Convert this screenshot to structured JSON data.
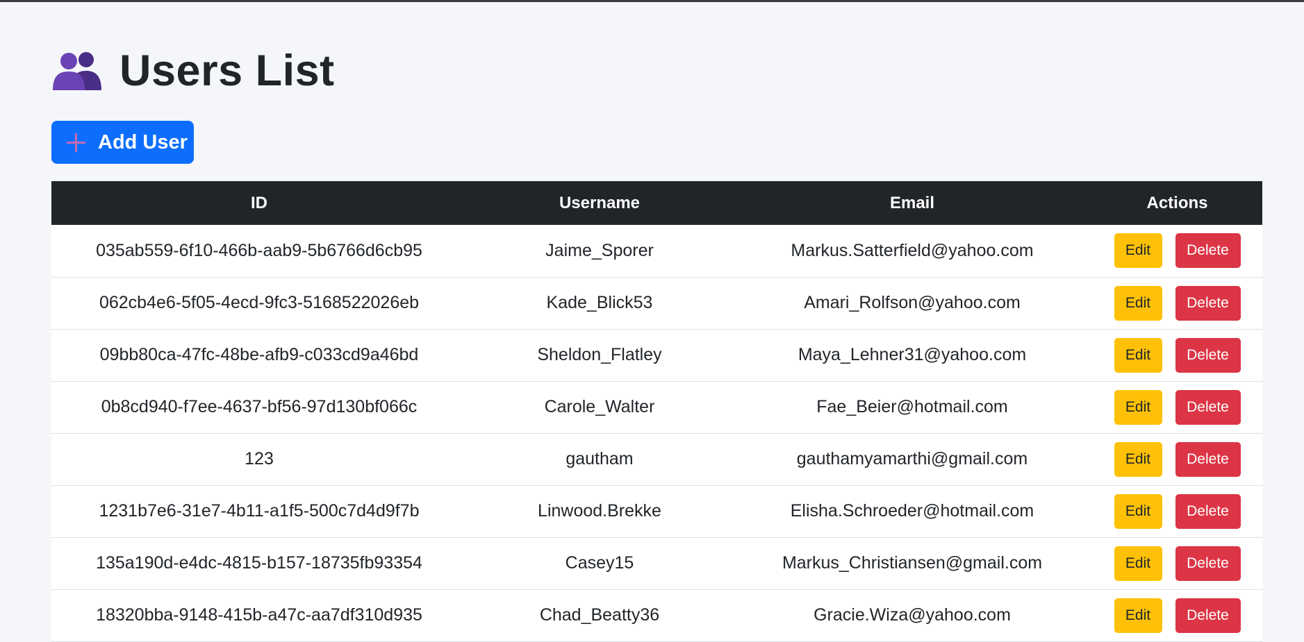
{
  "header": {
    "title": "Users List",
    "icon": "two-people-icon"
  },
  "toolbar": {
    "add_user_label": "Add User",
    "add_icon": "plus-icon"
  },
  "table": {
    "columns": [
      "ID",
      "Username",
      "Email",
      "Actions"
    ],
    "edit_label": "Edit",
    "delete_label": "Delete",
    "rows": [
      {
        "id": "035ab559-6f10-466b-aab9-5b6766d6cb95",
        "username": "Jaime_Sporer",
        "email": "Markus.Satterfield@yahoo.com"
      },
      {
        "id": "062cb4e6-5f05-4ecd-9fc3-5168522026eb",
        "username": "Kade_Blick53",
        "email": "Amari_Rolfson@yahoo.com"
      },
      {
        "id": "09bb80ca-47fc-48be-afb9-c033cd9a46bd",
        "username": "Sheldon_Flatley",
        "email": "Maya_Lehner31@yahoo.com"
      },
      {
        "id": "0b8cd940-f7ee-4637-bf56-97d130bf066c",
        "username": "Carole_Walter",
        "email": "Fae_Beier@hotmail.com"
      },
      {
        "id": "123",
        "username": "gautham",
        "email": "gauthamyamarthi@gmail.com"
      },
      {
        "id": "1231b7e6-31e7-4b11-a1f5-500c7d4d9f7b",
        "username": "Linwood.Brekke",
        "email": "Elisha.Schroeder@hotmail.com"
      },
      {
        "id": "135a190d-e4dc-4815-b157-18735fb93354",
        "username": "Casey15",
        "email": "Markus_Christiansen@gmail.com"
      },
      {
        "id": "18320bba-9148-415b-a47c-aa7df310d935",
        "username": "Chad_Beatty36",
        "email": "Gracie.Wiza@yahoo.com"
      }
    ]
  },
  "colors": {
    "primary": "#0d6efd",
    "warning": "#ffc107",
    "danger": "#dc3545",
    "header_dark": "#212529",
    "page_bg": "#f5f6fa",
    "icon_purple": "#5b3a9c"
  }
}
